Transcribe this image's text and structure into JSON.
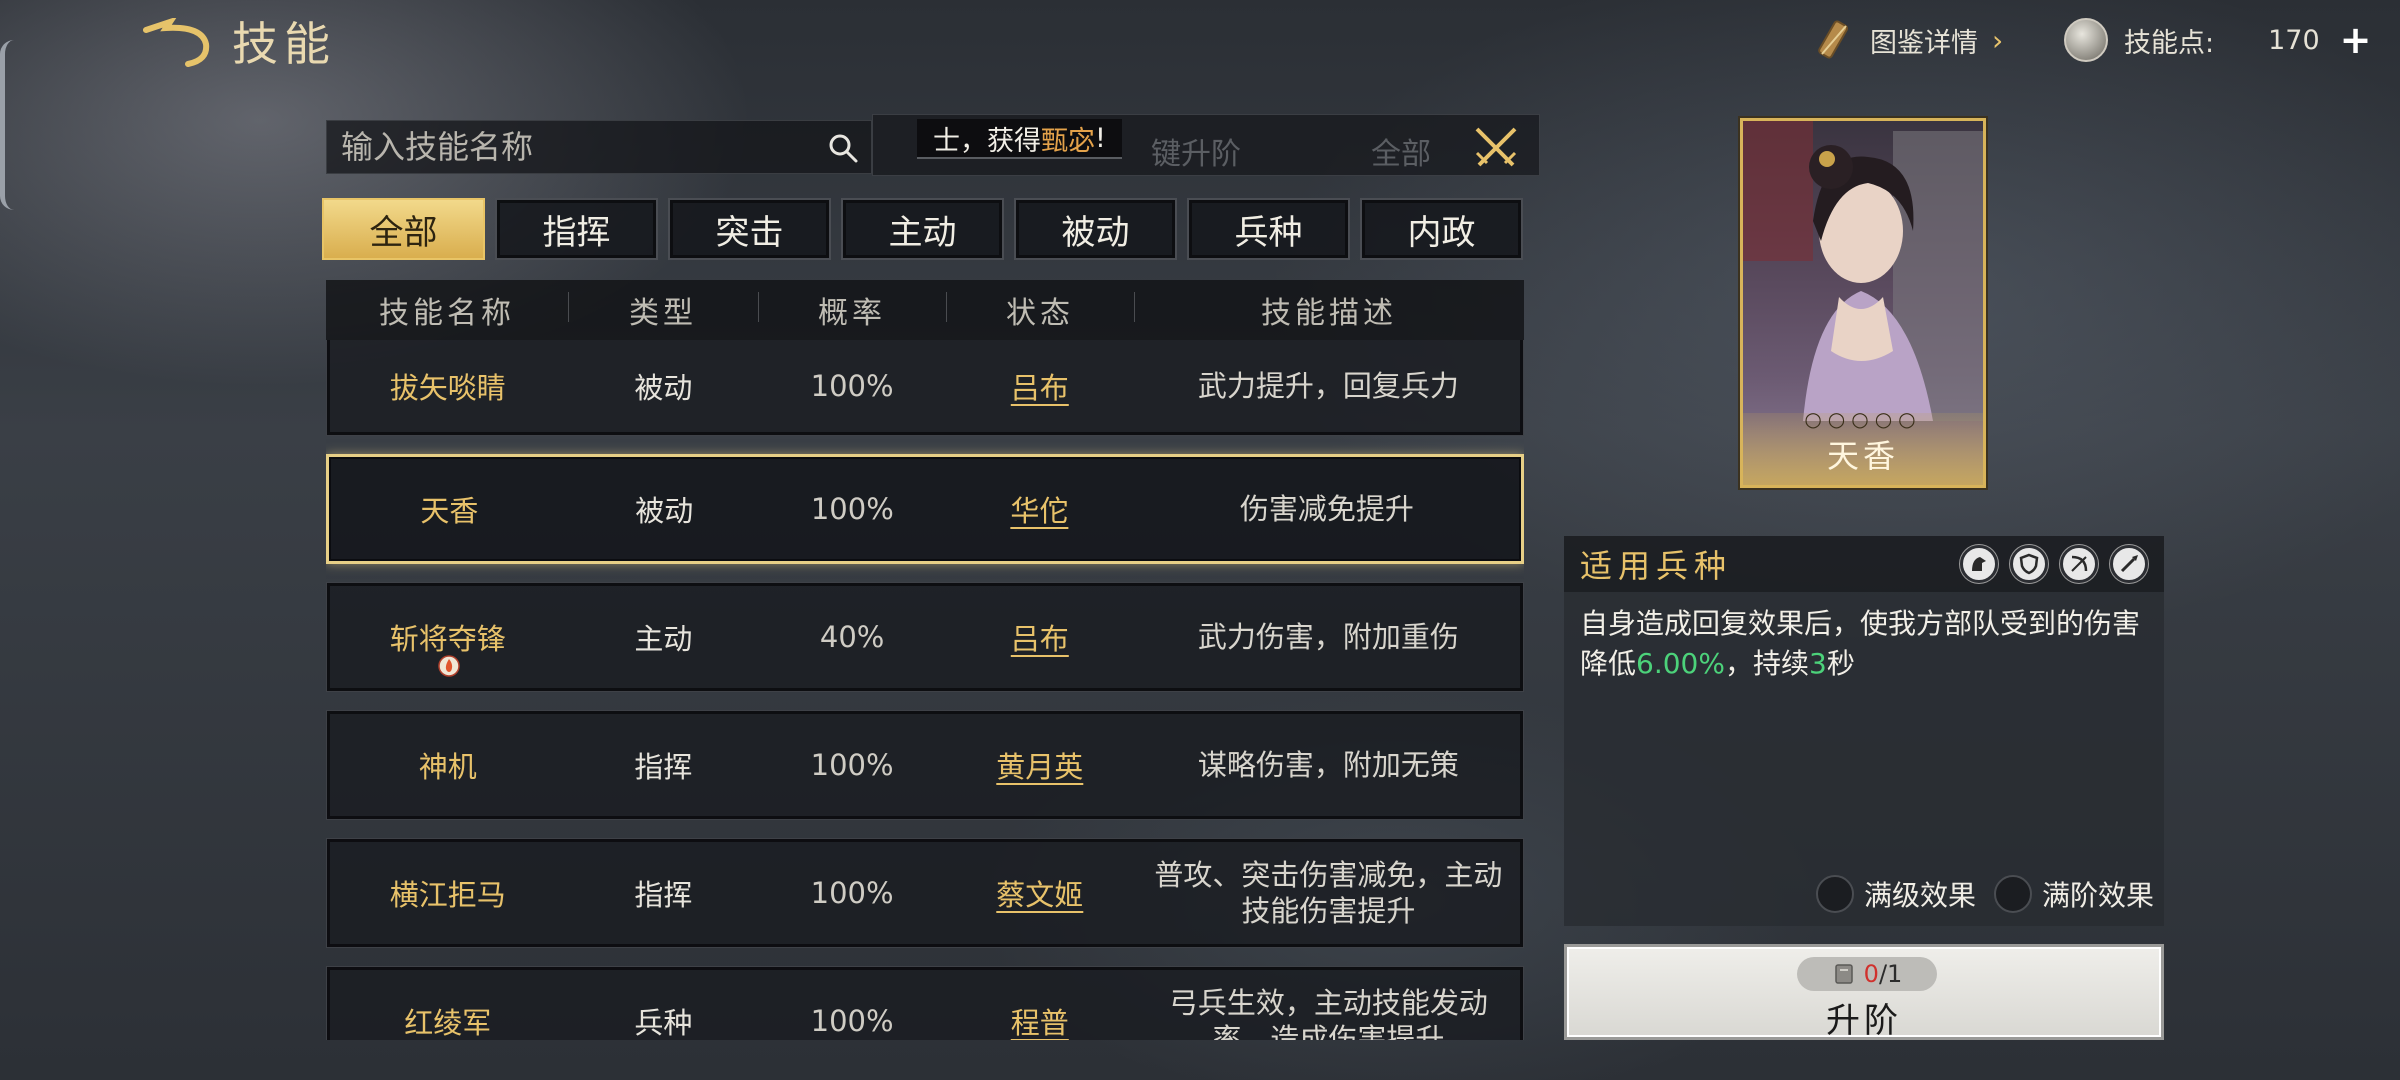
{
  "header": {
    "title": "技能",
    "codex_label": "图鉴详情",
    "points_label": "技能点:",
    "points_value": "170"
  },
  "search": {
    "placeholder": "输入技能名称",
    "ghost_labels": [
      "键升阶",
      "全部"
    ],
    "toast_prefix": "士，获得",
    "toast_highlight": "甄宓",
    "toast_suffix": "!"
  },
  "tabs": [
    "全部",
    "指挥",
    "突击",
    "主动",
    "被动",
    "兵种",
    "内政"
  ],
  "active_tab": "全部",
  "table": {
    "headers": [
      "技能名称",
      "类型",
      "概率",
      "状态",
      "技能描述"
    ],
    "rows": [
      {
        "name": "拔矢啖睛",
        "type": "被动",
        "rate": "100%",
        "general": "吕布",
        "desc": "武力提升，回复兵力"
      },
      {
        "name": "天香",
        "type": "被动",
        "rate": "100%",
        "general": "华佗",
        "desc": "伤害减免提升"
      },
      {
        "name": "斩将夺锋",
        "type": "主动",
        "rate": "40%",
        "general": "吕布",
        "desc": "武力伤害，附加重伤"
      },
      {
        "name": "神机",
        "type": "指挥",
        "rate": "100%",
        "general": "黄月英",
        "desc": "谋略伤害，附加无策"
      },
      {
        "name": "横江拒马",
        "type": "指挥",
        "rate": "100%",
        "general": "蔡文姬",
        "desc": "普攻、突击伤害减免，主动技能伤害提升"
      },
      {
        "name": "红绫军",
        "type": "兵种",
        "rate": "100%",
        "general": "程普",
        "desc": "弓兵生效，主动技能发动率，造成伤害提升"
      }
    ]
  },
  "hero": {
    "name": "天香",
    "stars": "○○○○○"
  },
  "detail": {
    "title": "适用兵种",
    "desc_1": "自身造成回复效果后，使我方部队受到的伤害降低",
    "desc_value": "6.00%",
    "desc_2": "，持续",
    "desc_seconds": "3",
    "desc_3": "秒",
    "unit_icons": [
      "cavalry-icon",
      "shield-icon",
      "bow-icon",
      "spear-icon"
    ],
    "toggle_max_level": "满级效果",
    "toggle_max_rank": "满阶效果"
  },
  "upgrade": {
    "cost_have": "0",
    "cost_total": "/1",
    "label": "升阶"
  },
  "colors": {
    "gold": "#e8c26a",
    "green": "#4cd27a",
    "red": "#d0312d"
  }
}
